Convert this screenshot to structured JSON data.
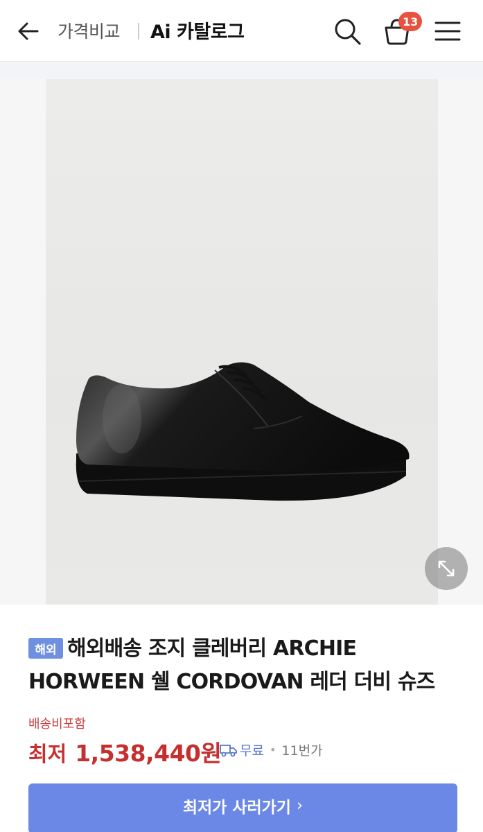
{
  "header": {
    "breadcrumb": "가격비교",
    "title": "Ai 카탈로그",
    "cart_count": "13"
  },
  "product": {
    "overseas_tag": "해외",
    "name": "해외배송 조지 클레버리 ARCHIE HORWEEN 쉘 CORDOVAN 레더 더비 슈즈 ARCH...",
    "shipping_note": "배송비포함",
    "price_label": "최저",
    "price": "1,538,440원",
    "delivery": "무료",
    "seller": "11번가"
  },
  "cta": {
    "label": "최저가 사러가기",
    "chevron": "›"
  },
  "colors": {
    "accent": "#6b88e6",
    "price": "#c62f2f",
    "badge": "#e8533f",
    "tag": "#6f8fe0"
  },
  "icons": [
    "back-arrow-icon",
    "search-icon",
    "cart-icon",
    "menu-icon",
    "expand-icon",
    "truck-icon"
  ]
}
